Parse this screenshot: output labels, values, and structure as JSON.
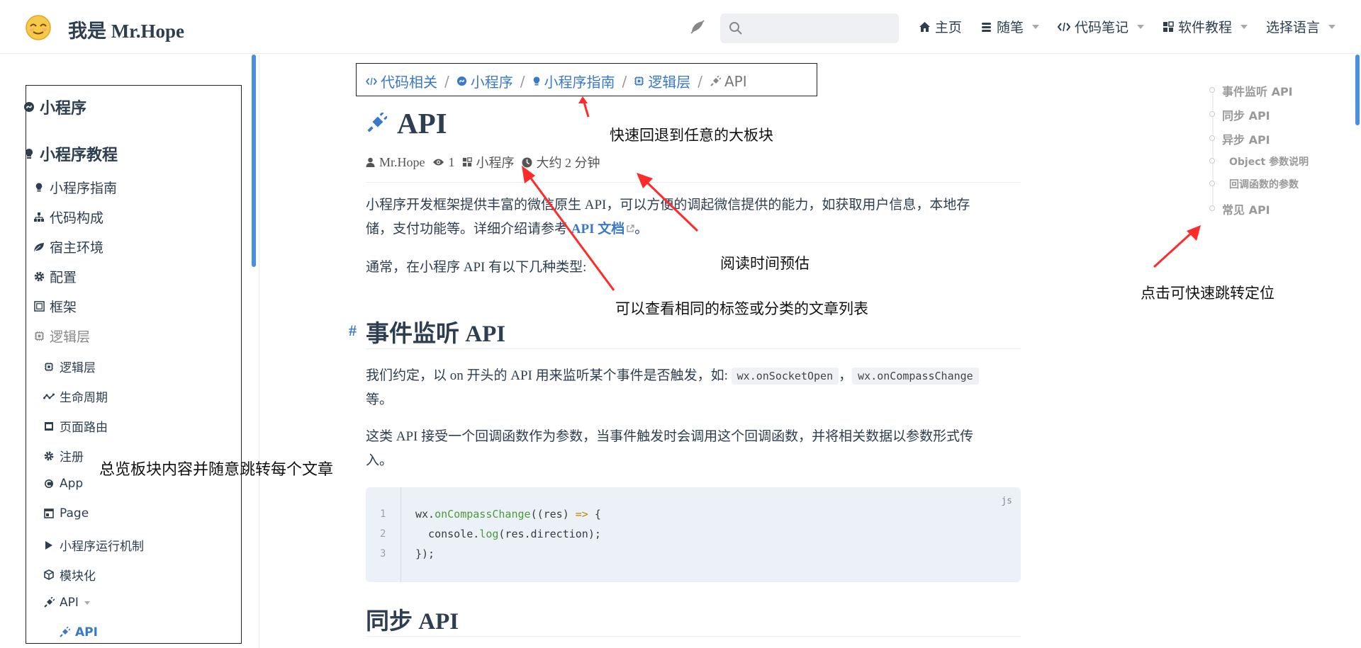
{
  "navbar": {
    "site_name": "我是 Mr.Hope",
    "search": {
      "placeholder": ""
    },
    "links": [
      {
        "label": "主页",
        "icon": "home-icon",
        "has_dropdown": false
      },
      {
        "label": "随笔",
        "icon": "stack-icon",
        "has_dropdown": true
      },
      {
        "label": "代码笔记",
        "icon": "code-icon",
        "has_dropdown": true
      },
      {
        "label": "软件教程",
        "icon": "grid-icon",
        "has_dropdown": true
      },
      {
        "label": "选择语言",
        "icon": "",
        "has_dropdown": true
      }
    ]
  },
  "sidebar": {
    "groups": [
      {
        "label": "小程序",
        "icon": "miniprogram-icon"
      },
      {
        "label": "小程序教程",
        "icon": "bulb-icon"
      }
    ],
    "items": [
      {
        "label": "小程序指南",
        "icon": "bulb-icon"
      },
      {
        "label": "代码构成",
        "icon": "tree-icon"
      },
      {
        "label": "宿主环境",
        "icon": "leaf-icon"
      },
      {
        "label": "配置",
        "icon": "gear-icon"
      },
      {
        "label": "框架",
        "icon": "frame-icon"
      },
      {
        "label": "逻辑层",
        "icon": "chip-icon"
      }
    ],
    "subitems": [
      {
        "label": "逻辑层",
        "icon": "chip-icon"
      },
      {
        "label": "生命周期",
        "icon": "wave-icon"
      },
      {
        "label": "页面路由",
        "icon": "route-icon"
      },
      {
        "label": "注册",
        "icon": "gear-icon"
      },
      {
        "label": "App",
        "icon": "app-icon"
      },
      {
        "label": "Page",
        "icon": "page-icon"
      },
      {
        "label": "小程序运行机制",
        "icon": "play-icon"
      },
      {
        "label": "模块化",
        "icon": "cube-icon"
      },
      {
        "label": "API",
        "icon": "plug-icon"
      }
    ],
    "active": {
      "label": "API",
      "icon": "plug-icon"
    }
  },
  "breadcrumb": {
    "items": [
      {
        "label": "代码相关",
        "icon": "code-icon"
      },
      {
        "label": "小程序",
        "icon": "miniprogram-icon"
      },
      {
        "label": "小程序指南",
        "icon": "bulb-icon"
      },
      {
        "label": "逻辑层",
        "icon": "chip-icon"
      }
    ],
    "current": "API",
    "separator": "/"
  },
  "article": {
    "title": "API",
    "meta": {
      "author": "Mr.Hope",
      "views": "1",
      "category": "小程序",
      "reading_time": "大约 2 分钟"
    },
    "intro_1a": "小程序开发框架提供丰富的微信原生 API，可以方便的调起微信提供的能力，如获取用户信息，本地存",
    "intro_1b": "储，支付功能等。详细介绍请参考 ",
    "intro_link": "API 文档",
    "intro_1c": "。",
    "intro_2": "通常，在小程序 API 有以下几种类型:",
    "section1": {
      "anchor": "#",
      "title": "事件监听 API",
      "p1_a": "我们约定，以 on 开头的 API 用来监听某个事件是否触发，如: ",
      "code1": "wx.onSocketOpen",
      "comma": "，",
      "code2": "wx.onCompassChange",
      "p1_b": "等。",
      "p2_a": "这类 API 接受一个回调函数作为参数，当事件触发时会调用这个回调函数，并将相关数据以参数形式传",
      "p2_b": "入。"
    },
    "code_block": {
      "lang": "js",
      "line_numbers": [
        "1",
        "2",
        "3"
      ],
      "line1_obj": "wx.",
      "line1_fn": "onCompassChange",
      "line1_args": "((res) ",
      "line1_arrow": "=>",
      "line1_end": " {",
      "line2_obj": "  console.",
      "line2_fn": "log",
      "line2_end": "(res.direction);",
      "line3": "});"
    },
    "section2": {
      "title": "同步 API"
    }
  },
  "toc": {
    "items": [
      {
        "label": "事件监听 API",
        "level": 1
      },
      {
        "label": "同步 API",
        "level": 1
      },
      {
        "label": "异步 API",
        "level": 1
      },
      {
        "label": "Object 参数说明",
        "level": 2
      },
      {
        "label": "回调函数的参数",
        "level": 2
      },
      {
        "label": "常见 API",
        "level": 1
      }
    ]
  },
  "annotations": {
    "breadcrumb_note": "快速回退到任意的大板块",
    "reading_time_note": "阅读时间预估",
    "category_note": "可以查看相同的标签或分类的文章列表",
    "toc_note": "点击可快速跳转定位",
    "sidebar_note": "总览板块内容并随意跳转每个文章"
  },
  "colors": {
    "accent": "#3a78c8",
    "annotation_arrow": "#ff2a2a",
    "code_bg": "#ecf1f7"
  }
}
